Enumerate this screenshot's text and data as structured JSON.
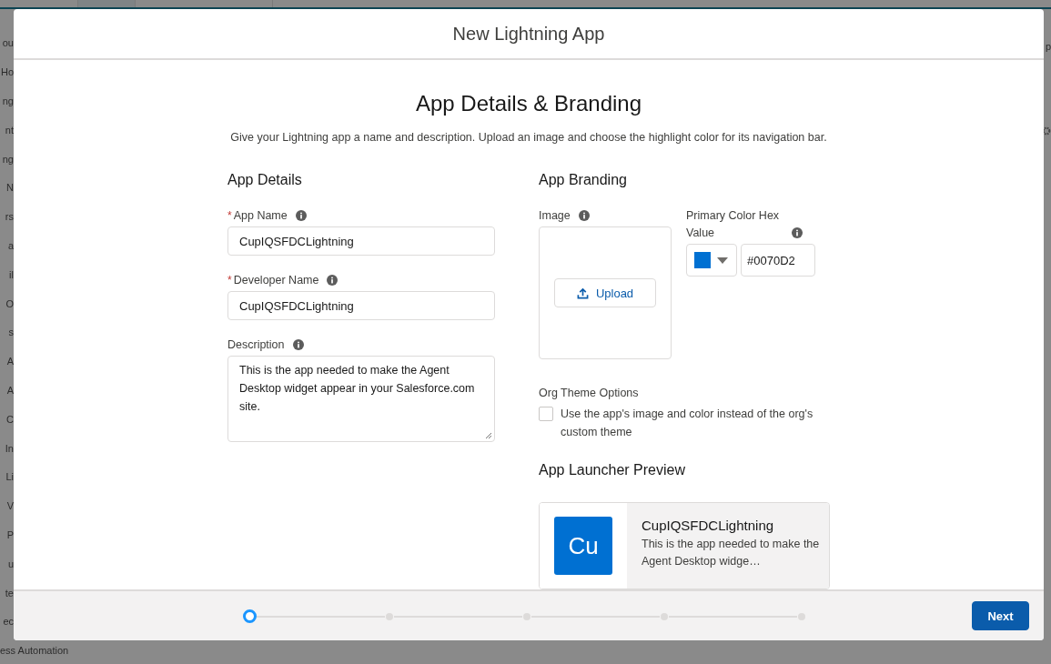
{
  "backdrop": {
    "side_fragments": [
      "ou",
      "Ho",
      "ng",
      "nt",
      "ng",
      "N",
      "rs",
      "a",
      "il",
      "O",
      "s",
      "A",
      "A",
      "C",
      "In",
      "Li",
      "V",
      "P",
      "u",
      "te",
      "ec",
      "ess Automation"
    ],
    "right_fragments": [
      "p"
    ]
  },
  "modal": {
    "title": "New Lightning App",
    "heading": "App Details & Branding",
    "intro": "Give your Lightning app a name and description. Upload an image and choose the highlight color for its navigation bar.",
    "app_details": {
      "title": "App Details",
      "fields": [
        {
          "required_mark": "*",
          "label": "App Name",
          "kind": "input",
          "value": "CupIQSFDCLightning"
        },
        {
          "required_mark": "*",
          "label": "Developer Name",
          "kind": "input",
          "value": "CupIQSFDCLightning"
        },
        {
          "label": "Description",
          "kind": "textarea",
          "value": "This is the app needed to make the Agent Desktop widget appear in your Salesforce.com site."
        }
      ]
    },
    "app_branding": {
      "title": "App Branding",
      "image_label": "Image",
      "upload_button": "Upload",
      "color_label": "Primary Color Hex Value",
      "color_value": "#0070D2",
      "theme_label": "Org Theme Options",
      "theme_option": {
        "label": "Use the app's image and color instead of the org's custom theme",
        "checked": false
      }
    },
    "preview": {
      "title": "App Launcher Preview",
      "tile": "Cu",
      "name": "CupIQSFDCLightning",
      "description": "This is the app needed to make the Agent Desktop widge…"
    },
    "steps": [
      {
        "selected": true
      },
      {
        "selected": false
      },
      {
        "selected": false
      },
      {
        "selected": false
      },
      {
        "selected": false
      }
    ],
    "next_button": "Next"
  }
}
